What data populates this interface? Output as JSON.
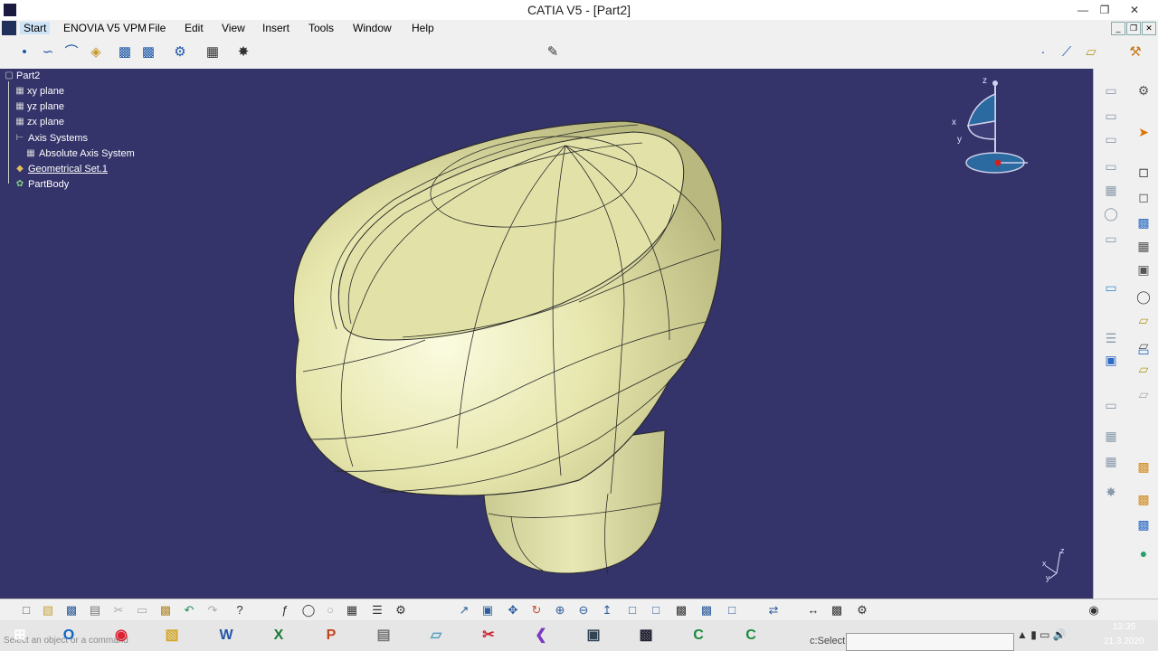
{
  "window": {
    "title": "CATIA V5 - [Part2]"
  },
  "menubar": {
    "items": [
      "Start",
      "ENOVIA V5 VPM",
      "File",
      "Edit",
      "View",
      "Insert",
      "Tools",
      "Window",
      "Help"
    ]
  },
  "tree": {
    "root": "Part2",
    "items": [
      {
        "label": "xy plane"
      },
      {
        "label": "yz plane"
      },
      {
        "label": "zx plane"
      },
      {
        "label": "Axis Systems"
      },
      {
        "label": "Absolute Axis System"
      },
      {
        "label": "Geometrical Set.1"
      },
      {
        "label": "PartBody"
      }
    ]
  },
  "compass": {
    "x": "x",
    "y": "y",
    "z": "z"
  },
  "axis_triad": {
    "z": "z",
    "x": "x",
    "y": "y"
  },
  "statusbar": {
    "hint": "Select an object or a command",
    "command_label": "c:Select",
    "command_value": ""
  },
  "taskbar": {
    "time": "13:35",
    "date": "21.3.2020"
  },
  "icons": {
    "toolbar_top": [
      "point-icon",
      "spline-icon",
      "surface-icon",
      "sketch-icon",
      "pocket-icon",
      "pad-icon",
      "view-gear-icon",
      "grid-icon",
      "snap-icon"
    ],
    "colors": {
      "viewport": "#34336a",
      "part": "#e6e6ad",
      "edges": "#2b2b2b"
    }
  }
}
